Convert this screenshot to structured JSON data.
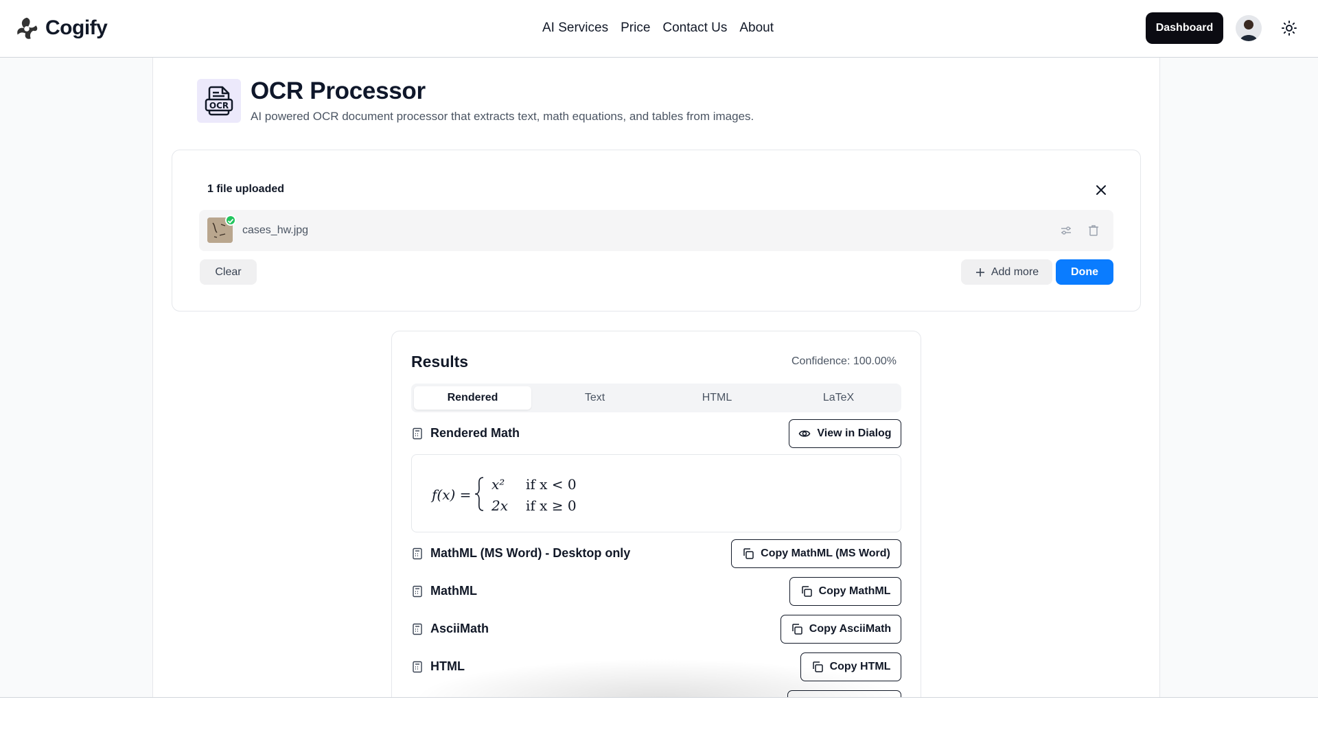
{
  "header": {
    "brand": "Cogify",
    "nav": [
      "AI Services",
      "Price",
      "Contact Us",
      "About"
    ],
    "dashboard_label": "Dashboard"
  },
  "page": {
    "title": "OCR Processor",
    "subtitle": "AI powered OCR document processor that extracts text, math equations, and tables from images.",
    "icon_text": "OCR"
  },
  "upload": {
    "count_label": "1 file uploaded",
    "file_name": "cases_hw.jpg",
    "clear_label": "Clear",
    "add_more_label": "Add more",
    "done_label": "Done"
  },
  "results": {
    "title": "Results",
    "confidence": "Confidence: 100.00%",
    "tabs": [
      "Rendered",
      "Text",
      "HTML",
      "LaTeX"
    ],
    "active_tab": "Rendered",
    "rendered_math_label": "Rendered Math",
    "view_dialog_label": "View in Dialog",
    "equation": {
      "lhs": "f(x) =",
      "case1_expr": "x²",
      "case1_cond": "if x < 0",
      "case2_expr": "2x",
      "case2_cond": "if x ≥ 0"
    },
    "formats": [
      {
        "label": "MathML (MS Word) - Desktop only",
        "button": "Copy MathML (MS Word)"
      },
      {
        "label": "MathML",
        "button": "Copy MathML"
      },
      {
        "label": "AsciiMath",
        "button": "Copy AsciiMath"
      },
      {
        "label": "HTML",
        "button": "Copy HTML"
      }
    ]
  },
  "colors": {
    "primary": "#0a7cff",
    "dark_button": "#0b0b12",
    "success": "#22c55e"
  }
}
